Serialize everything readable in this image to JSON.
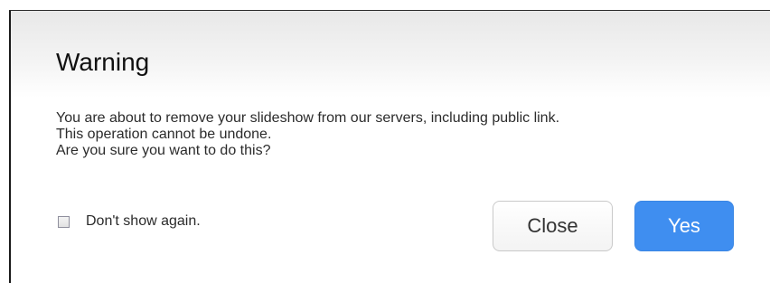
{
  "dialog": {
    "title": "Warning",
    "message_lines": [
      "You are about to remove your slideshow from our servers, including public link.",
      "This operation cannot be undone.",
      "Are you sure you want to do this?"
    ],
    "checkbox": {
      "label": "Don't show again.",
      "checked": false
    },
    "buttons": {
      "close_label": "Close",
      "yes_label": "Yes"
    }
  },
  "colors": {
    "primary_button": "#3f8ef0",
    "secondary_button": "#f6f6f6",
    "text": "#2b2b2b"
  }
}
